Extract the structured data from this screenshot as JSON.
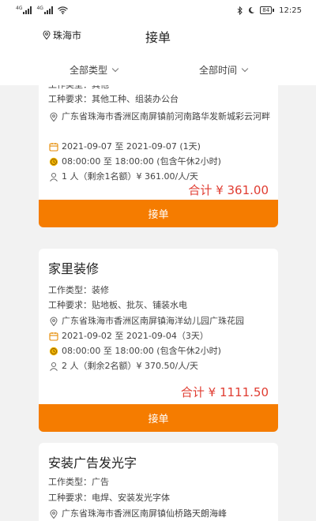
{
  "status_bar": {
    "signal_tags": [
      "4G",
      "4G"
    ],
    "battery": "84",
    "time": "12:25"
  },
  "header": {
    "city": "珠海市",
    "title": "接单"
  },
  "filters": {
    "type_label": "全部类型",
    "time_label": "全部时间"
  },
  "colors": {
    "accent": "#f57c00",
    "price": "#e03c31"
  },
  "labels": {
    "work_type": "工作类型：",
    "work_req": "工种要求：",
    "accept": "接单"
  },
  "jobs": [
    {
      "work_type": "其他",
      "requirement": "其他工种、组装办公台",
      "address": "广东省珠海市香洲区南屏镇前河南路华发新城彩云河畔",
      "date": "2021-09-07 至 2021-09-07 (1天)",
      "time": "08:00:00 至 18:00:00 (包含午休2小时)",
      "people": "1 人（剩余1名额）¥ 361.00/人/天",
      "total": "合计 ¥ 361.00"
    },
    {
      "title": "家里装修",
      "work_type": "装修",
      "requirement": "贴地板、批灰、铺装水电",
      "address": "广东省珠海市香洲区南屏镇海洋幼儿园广珠花园",
      "date": "2021-09-02 至 2021-09-04（3天）",
      "time": "08:00:00 至 18:00:00 (包含午休2小时)",
      "people": "2 人（剩余2名额）¥ 370.50/人/天",
      "total": "合计 ¥ 1111.50"
    },
    {
      "title": "安装广告发光字",
      "work_type": "广告",
      "requirement": "电焊、安装发光字体",
      "address": "广东省珠海市香洲区南屏镇仙桥路天朗海峰"
    }
  ]
}
